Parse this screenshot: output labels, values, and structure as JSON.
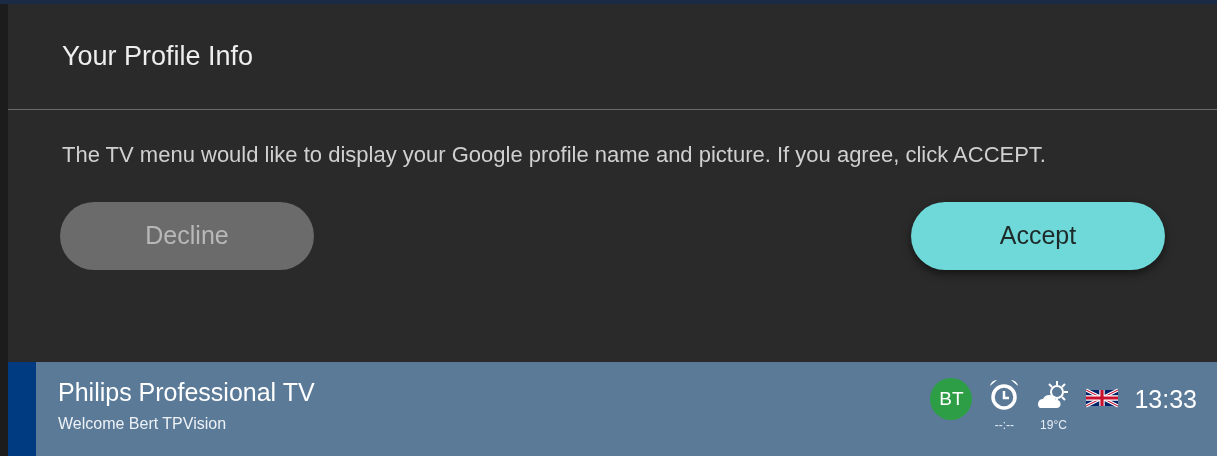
{
  "dialog": {
    "title": "Your Profile Info",
    "message": "The TV menu would like to display your Google profile name and picture. If you agree, click ACCEPT.",
    "buttons": [
      {
        "label": "Decline",
        "selected": false
      },
      {
        "label": "Accept",
        "selected": true
      }
    ]
  },
  "status_bar": {
    "title": "Philips Professional TV",
    "subtitle": "Welcome Bert TPVision",
    "avatar": "BT",
    "alarm": "--:--",
    "temperature": "19°C",
    "time": "13:33"
  }
}
